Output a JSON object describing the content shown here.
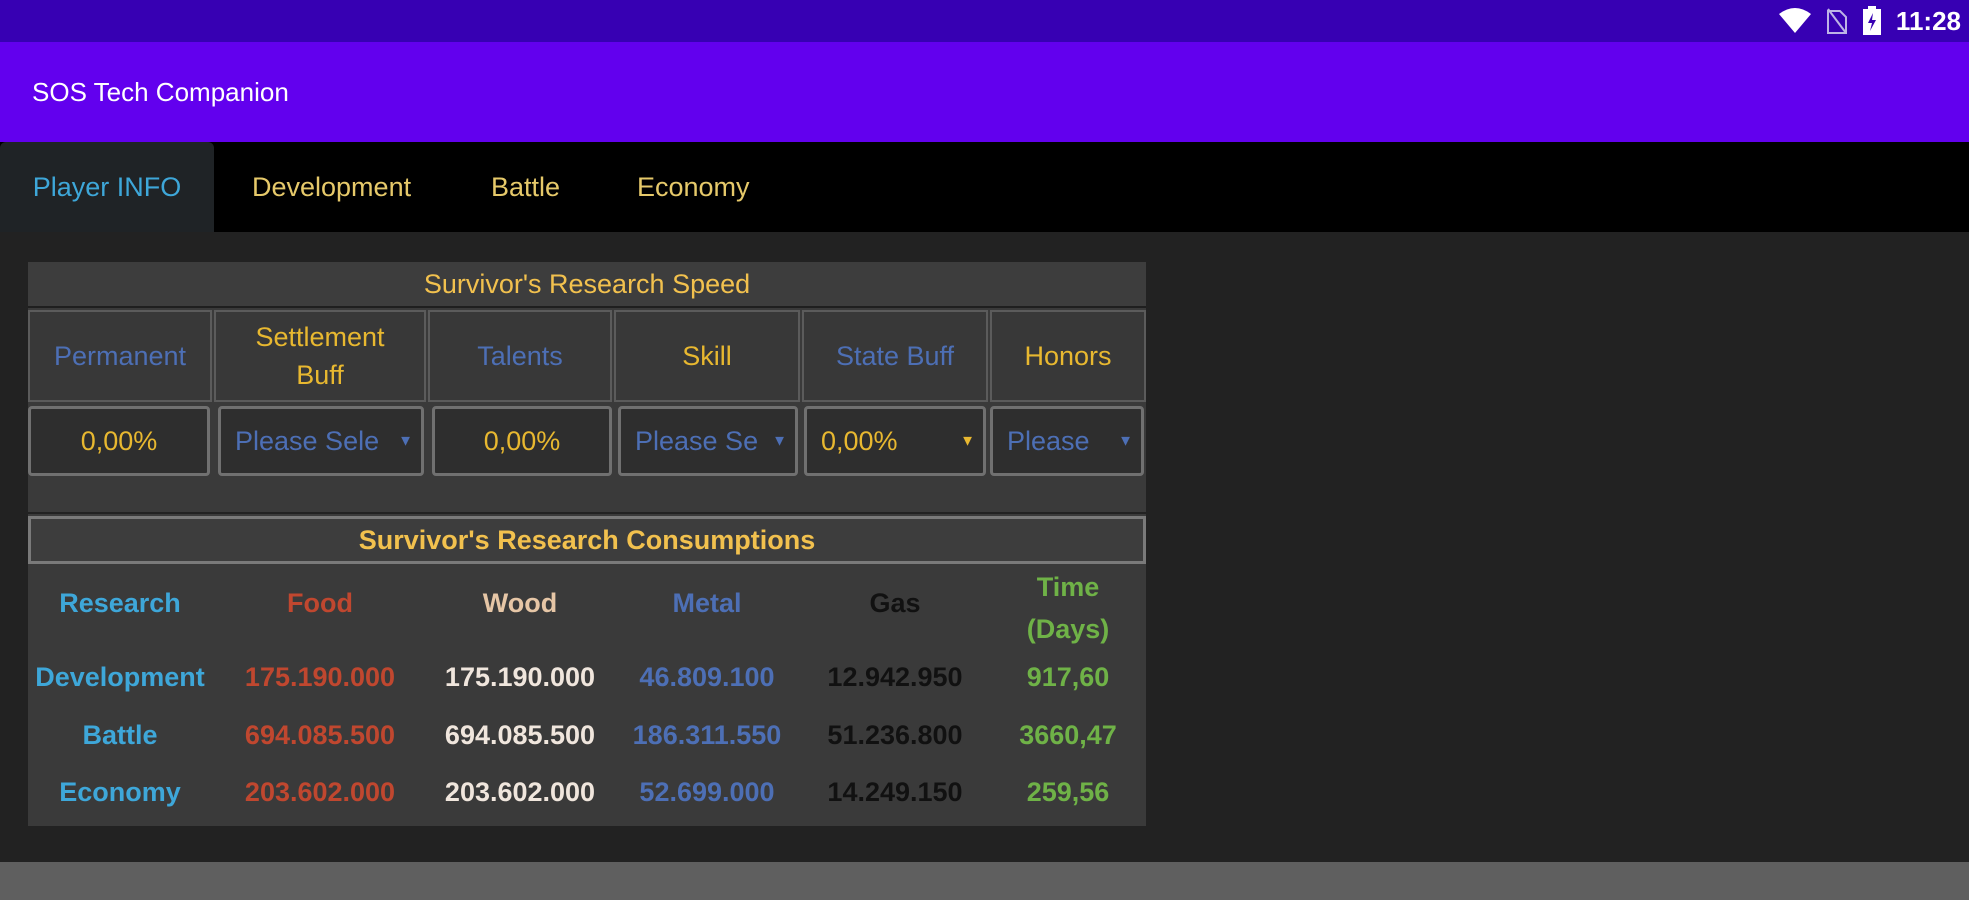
{
  "status_bar": {
    "time": "11:28",
    "icons": [
      "wifi-icon",
      "no-sim-icon",
      "battery-icon"
    ]
  },
  "app_bar": {
    "title": "SOS Tech Companion"
  },
  "tabs": [
    {
      "label": "Player INFO",
      "active": true
    },
    {
      "label": "Development",
      "active": false
    },
    {
      "label": "Battle",
      "active": false
    },
    {
      "label": "Economy",
      "active": false
    }
  ],
  "research_speed": {
    "title": "Survivor's Research Speed",
    "headers": [
      "Permanent",
      "Settlement Buff",
      "Talents",
      "Skill",
      "State Buff",
      "Honors"
    ],
    "values": [
      "0,00%",
      "Please Sele",
      "0,00%",
      "Please Se",
      "0,00%",
      "Please"
    ]
  },
  "consumptions": {
    "title": "Survivor's Research Consumptions",
    "headers": {
      "research": "Research",
      "food": "Food",
      "wood": "Wood",
      "metal": "Metal",
      "gas": "Gas",
      "time": "Time (Days)"
    },
    "rows": [
      {
        "research": "Development",
        "food": "175.190.000",
        "wood": "175.190.000",
        "metal": "46.809.100",
        "gas": "12.942.950",
        "time": "917,60"
      },
      {
        "research": "Battle",
        "food": "694.085.500",
        "wood": "694.085.500",
        "metal": "186.311.550",
        "gas": "51.236.800",
        "time": "3660,47"
      },
      {
        "research": "Economy",
        "food": "203.602.000",
        "wood": "203.602.000",
        "metal": "52.699.000",
        "gas": "14.249.150",
        "time": "259,56"
      }
    ]
  },
  "colors": {
    "status_bar": "#3700B3",
    "app_bar": "#6200EE",
    "accent_gold": "#F2C14E",
    "accent_blue": "#3EA7D9"
  }
}
